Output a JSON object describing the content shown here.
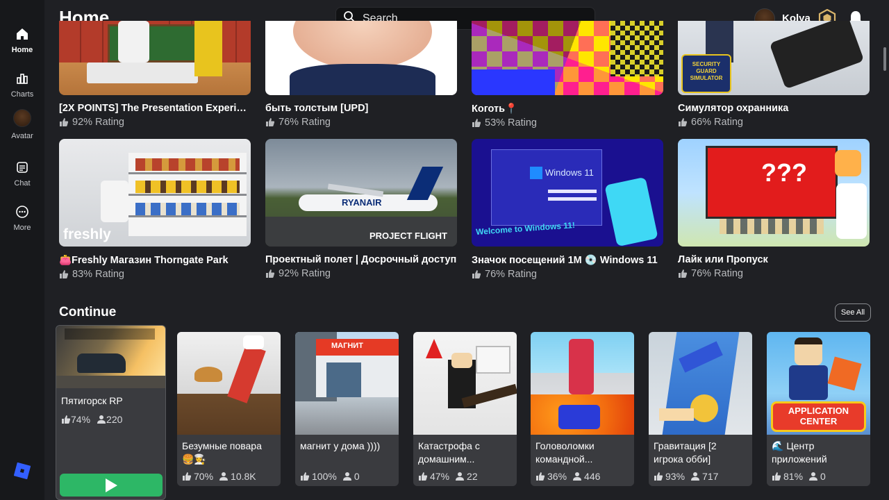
{
  "sidebar": {
    "items": [
      {
        "label": "Home",
        "icon": "home-icon"
      },
      {
        "label": "Charts",
        "icon": "charts-icon"
      },
      {
        "label": "Avatar",
        "icon": "avatar-icon"
      },
      {
        "label": "Chat",
        "icon": "chat-icon"
      },
      {
        "label": "More",
        "icon": "more-icon"
      }
    ]
  },
  "header": {
    "title": "Home",
    "search_placeholder": "Search",
    "username": "Kolya"
  },
  "games": [
    {
      "title": "[2X POINTS] The Presentation Experience",
      "rating": "92% Rating"
    },
    {
      "title": "быть толстым [UPD]",
      "rating": "76% Rating"
    },
    {
      "title": "Коготь📍",
      "rating": "53% Rating"
    },
    {
      "title": "Симулятор охранника",
      "rating": "66% Rating"
    },
    {
      "title": "👛Freshly Магазин Thorngate Park",
      "rating": "83% Rating"
    },
    {
      "title": "Проектный полет | Досрочный доступ",
      "rating": "92% Rating"
    },
    {
      "title": "Значок посещений 1M 💿 Windows 11",
      "rating": "76% Rating"
    },
    {
      "title": "Лайк или Пропуск",
      "rating": "76% Rating"
    }
  ],
  "thumb_text": {
    "security": "SECURITY GUARD SIMULATOR",
    "freshly": "freshly",
    "ryanair": "RYANAIR",
    "project_flight": "PROJECT FLIGHT",
    "windows": "Windows 11",
    "welcome": "Welcome to Windows 11!",
    "question": "???",
    "magnit": "МАГНИТ",
    "app_center": "APPLICATION CENTER"
  },
  "continue": {
    "title": "Continue",
    "see_all": "See All",
    "featured": {
      "title": "Пятигорск RP",
      "rating": "74%",
      "players": "220"
    },
    "items": [
      {
        "title": "Безумные повара 🍔👩‍🍳",
        "rating": "70%",
        "players": "10.8K"
      },
      {
        "title": "магнит у дома ))))",
        "rating": "100%",
        "players": "0"
      },
      {
        "title": "Катастрофа с домашним...",
        "rating": "47%",
        "players": "22"
      },
      {
        "title": "Головоломки командной...",
        "rating": "36%",
        "players": "446"
      },
      {
        "title": "Гравитация [2 игрока обби]",
        "rating": "93%",
        "players": "717"
      },
      {
        "title": "🌊 Центр приложений",
        "rating": "81%",
        "players": "0"
      }
    ]
  },
  "colors": {
    "background": "#1f2024",
    "sidebar": "#17181b",
    "card": "#3a3b3f",
    "play": "#2db766",
    "brand": "#335fff"
  }
}
